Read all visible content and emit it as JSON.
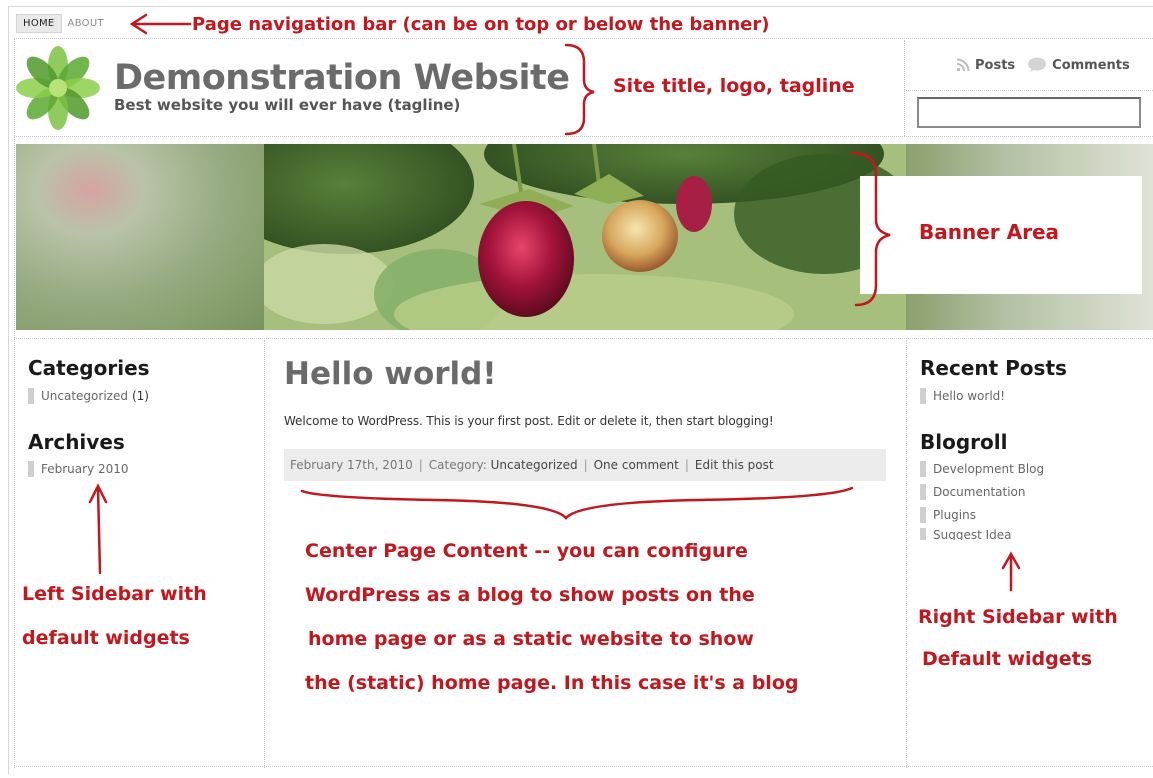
{
  "nav": {
    "items": [
      {
        "label": "HOME",
        "active": true
      },
      {
        "label": "ABOUT",
        "active": false
      }
    ]
  },
  "header": {
    "site_title": "Demonstration Website",
    "tagline": "Best website you will ever have (tagline)",
    "logo_icon": "green-flower-logo-icon",
    "feeds": [
      {
        "label": "Posts",
        "icon": "rss-icon"
      },
      {
        "label": "Comments",
        "icon": "comment-bubble-icon"
      }
    ],
    "search": {
      "value": "",
      "placeholder": ""
    }
  },
  "left_sidebar": {
    "categories": {
      "title": "Categories",
      "items": [
        {
          "label": "Uncategorized",
          "count": "(1)"
        }
      ]
    },
    "archives": {
      "title": "Archives",
      "items": [
        {
          "label": "February 2010"
        }
      ]
    }
  },
  "post": {
    "title": "Hello world!",
    "body": "Welcome to WordPress. This is your first post. Edit or delete it, then start blogging!",
    "meta": {
      "date": "February 17th, 2010",
      "category_prefix": "Category:",
      "category": "Uncategorized",
      "comments": "One comment",
      "edit": "Edit this post"
    }
  },
  "right_sidebar": {
    "recent_posts": {
      "title": "Recent Posts",
      "items": [
        {
          "label": "Hello world!"
        }
      ]
    },
    "blogroll": {
      "title": "Blogroll",
      "items": [
        {
          "label": "Development Blog"
        },
        {
          "label": "Documentation"
        },
        {
          "label": "Plugins"
        },
        {
          "label": "Suggest Idea"
        }
      ]
    }
  },
  "annotations": {
    "nav": "Page navigation bar (can be on top or below the banner)",
    "header": "Site title, logo, tagline",
    "banner": "Banner Area",
    "left": [
      "Left Sidebar with",
      "default widgets"
    ],
    "center": [
      "Center Page Content -- you can configure",
      "WordPress as a blog  to show posts on the",
      "home page or as a static website  to show",
      "the (static) home page.  In this case it's a blog"
    ],
    "right": [
      "Right Sidebar with",
      "Default widgets"
    ],
    "color": "#c4161c"
  }
}
